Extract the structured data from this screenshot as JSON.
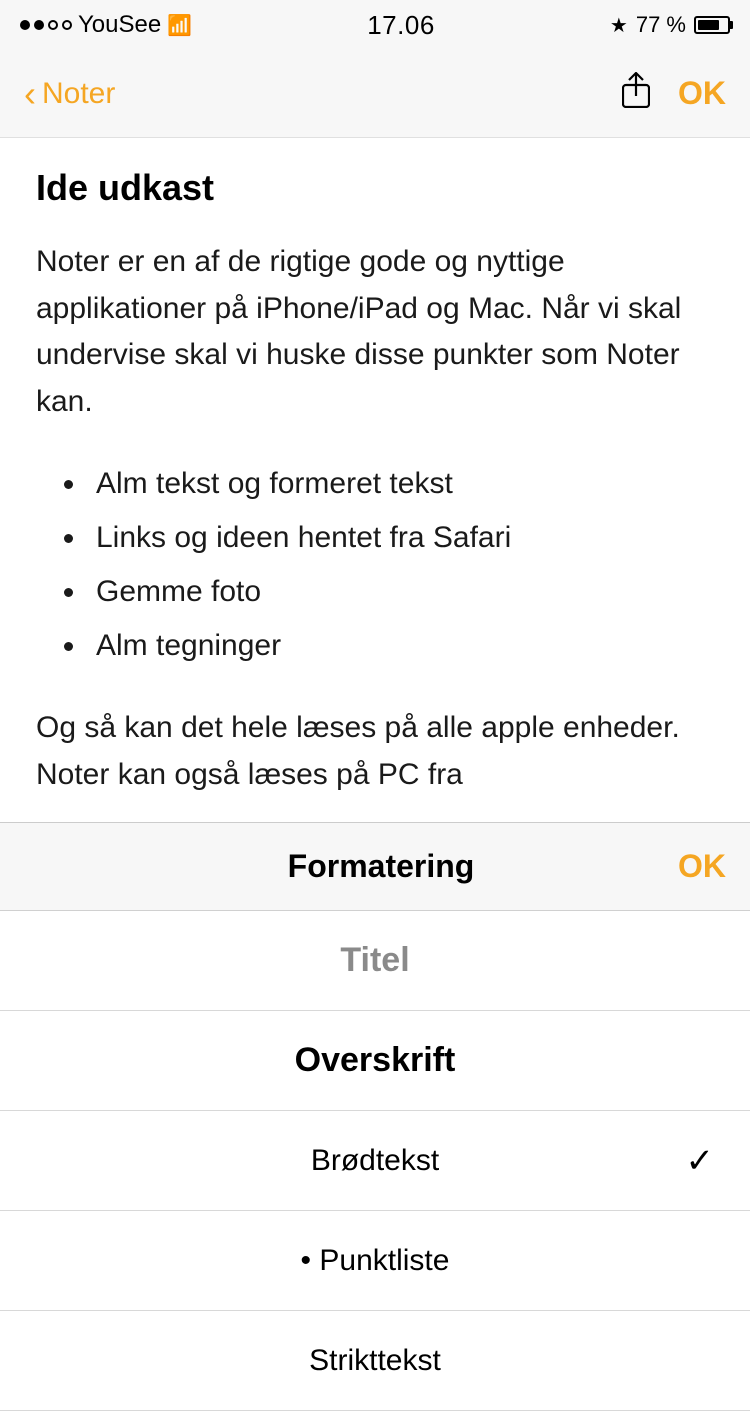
{
  "status_bar": {
    "carrier": "YouSee",
    "time": "17.06",
    "battery_pct": "77 %",
    "signal_filled": 2,
    "signal_empty": 2
  },
  "nav": {
    "back_label": "Noter",
    "ok_label": "OK"
  },
  "note": {
    "title": "Ide udkast",
    "body1": "Noter er en af de rigtige gode og nyttige applikationer på iPhone/iPad og Mac. Når vi skal undervise skal vi huske disse punkter som Noter kan.",
    "bullets": [
      "Alm tekst og formeret tekst",
      "Links og  ideen hentet fra Safari",
      "Gemme foto",
      "Alm tegninger"
    ],
    "body2": "Og så kan det hele læses på alle apple enheder. Noter kan også læses på PC fra"
  },
  "formatting": {
    "panel_title": "Formatering",
    "ok_label": "OK",
    "options": [
      {
        "label": "Titel",
        "style": "titel",
        "checked": false
      },
      {
        "label": "Overskrift",
        "style": "overskrift",
        "checked": false
      },
      {
        "label": "Brødtekst",
        "style": "brodtekst",
        "checked": true
      },
      {
        "label": "• Punktliste",
        "style": "punktliste",
        "checked": false
      },
      {
        "label": "Strikttekst",
        "style": "strikttekst",
        "checked": false
      }
    ]
  }
}
